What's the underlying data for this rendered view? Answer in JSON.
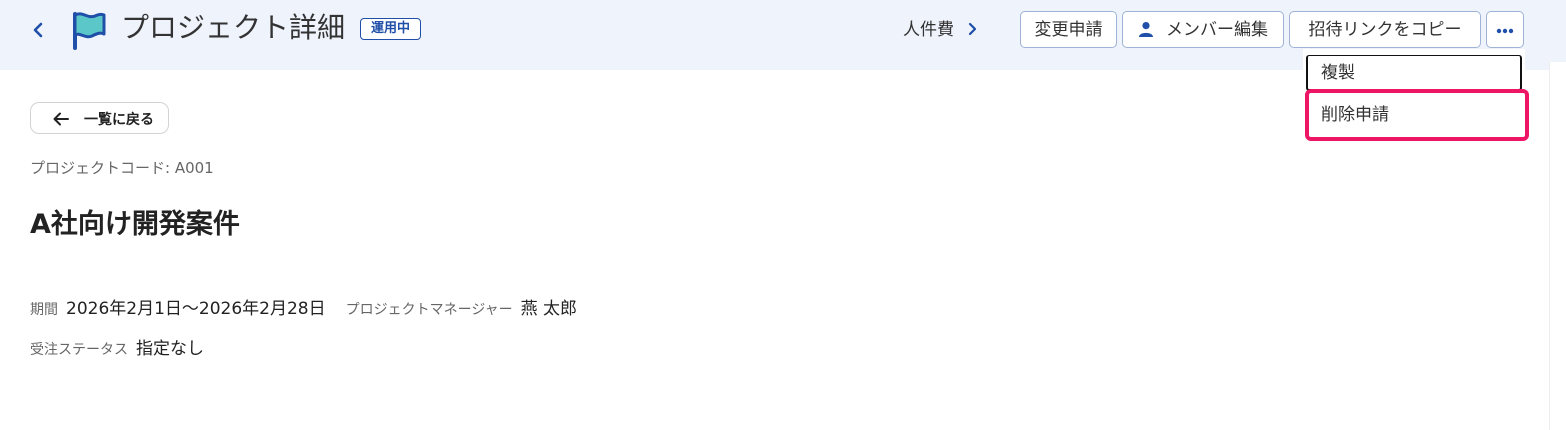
{
  "header": {
    "title": "プロジェクト詳細",
    "status_badge": "運用中",
    "labor_cost_link": "人件費",
    "buttons": {
      "change_request": "変更申請",
      "member_edit": "メンバー編集",
      "copy_invite_link": "招待リンクをコピー"
    },
    "colors": {
      "header_bg": "#eef3fc",
      "accent": "#1f4fa8",
      "flag_fill": "#5cc7c9",
      "highlight": "#ee1566"
    },
    "icons": [
      "chevron-left-icon",
      "flag-icon",
      "chevron-right-icon",
      "person-icon",
      "more-horizontal-icon"
    ]
  },
  "more_menu": {
    "items": [
      {
        "label": "複製"
      },
      {
        "label": "削除申請",
        "highlighted": true
      }
    ]
  },
  "body": {
    "back_to_list": "一覧に戻る",
    "project_code_label": "プロジェクトコード: A001",
    "project_name": "A社向け開発案件",
    "period_label": "期間",
    "period_value": "2026年2月1日〜2026年2月28日",
    "manager_label": "プロジェクトマネージャー",
    "manager_value": "燕 太郎",
    "order_status_label": "受注ステータス",
    "order_status_value": "指定なし"
  }
}
